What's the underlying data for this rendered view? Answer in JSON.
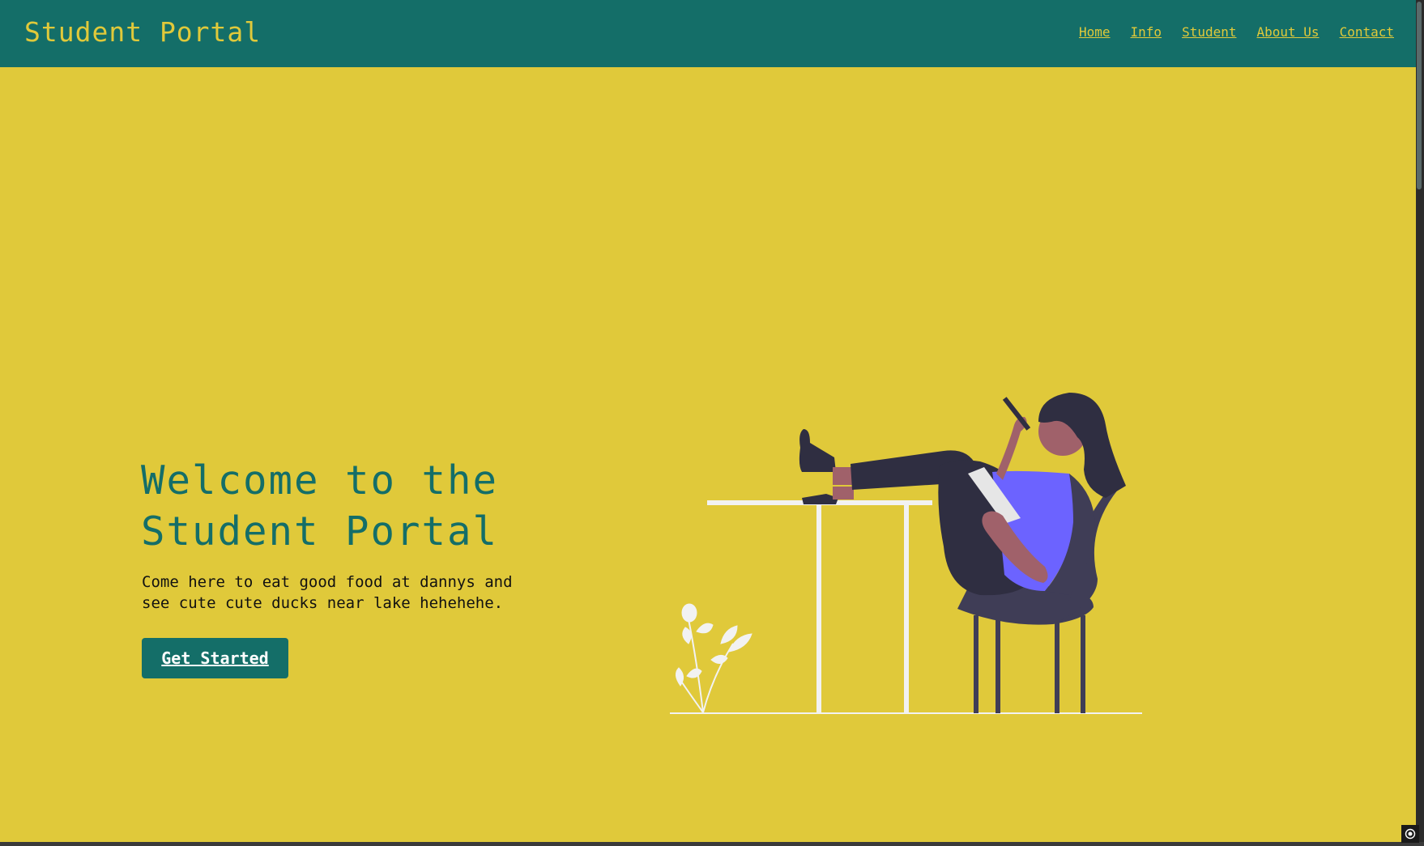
{
  "navbar": {
    "brand": "Student Portal",
    "links": [
      "Home",
      "Info",
      "Student",
      "About Us",
      "Contact"
    ]
  },
  "hero": {
    "title_line1": "Welcome to the",
    "title_line2": "Student Portal",
    "description": "Come here to eat good food at dannys and see cute cute ducks near lake hehehehe.",
    "cta_label": "Get Started"
  },
  "colors": {
    "primary": "#146e68",
    "background": "#e0c93a",
    "accent": "#6c63ff",
    "dark": "#2f2e41"
  },
  "illustration": {
    "icon": "woman-sitting-with-phone-illustration"
  }
}
